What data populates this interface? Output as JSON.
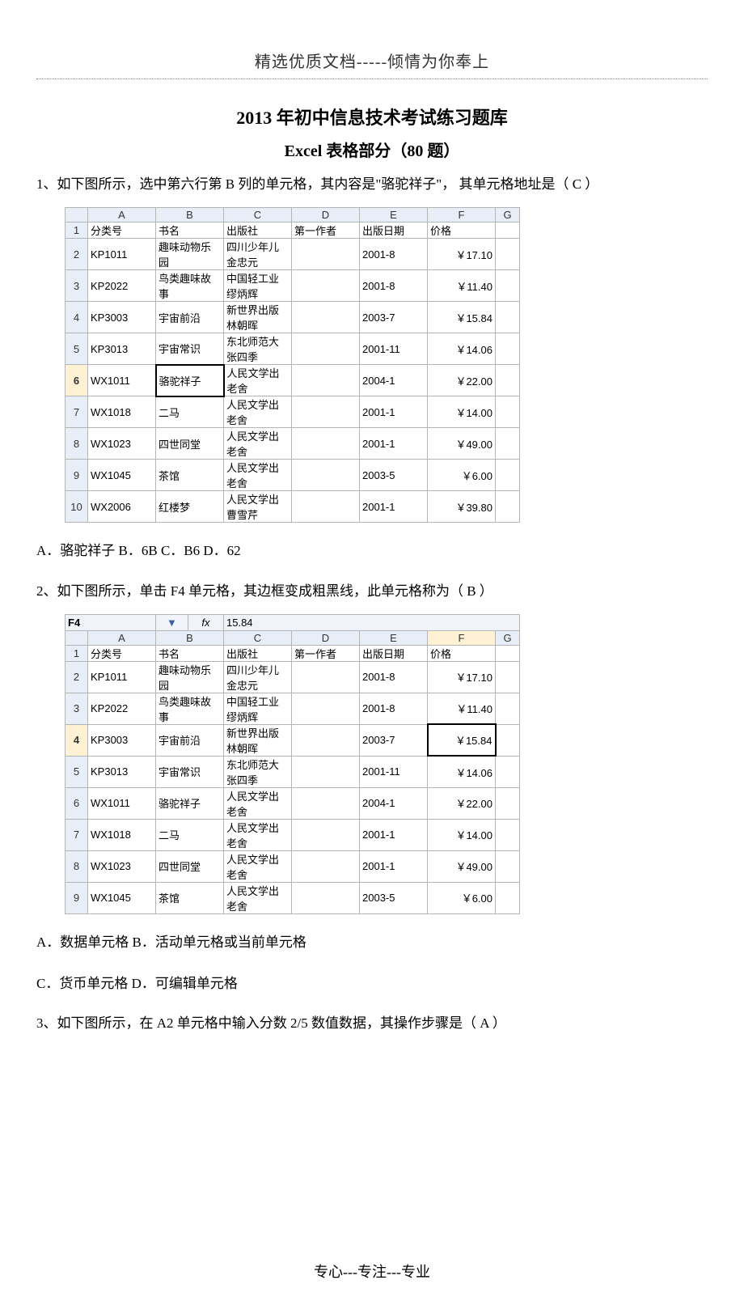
{
  "header": "精选优质文档-----倾情为你奉上",
  "title": "2013 年初中信息技术考试练习题库",
  "subtitle": "Excel 表格部分（80 题）",
  "q1": {
    "text": "1、如下图所示，选中第六行第 B 列的单元格，其内容是\"骆驼祥子\"， 其单元格地址是（   C        ）",
    "columns": [
      "A",
      "B",
      "C",
      "D",
      "E",
      "F",
      "G"
    ],
    "rows": [
      [
        "1",
        "分类号",
        "书名",
        "出版社",
        "第一作者",
        "出版日期",
        "价格",
        ""
      ],
      [
        "2",
        "KP1011",
        "趣味动物乐园",
        "四川少年儿金忠元",
        "",
        "2001-8",
        "￥17.10",
        ""
      ],
      [
        "3",
        "KP2022",
        "鸟类趣味故事",
        "中国轻工业缪炳辉",
        "",
        "2001-8",
        "￥11.40",
        ""
      ],
      [
        "4",
        "KP3003",
        "宇宙前沿",
        "新世界出版林朝晖",
        "",
        "2003-7",
        "￥15.84",
        ""
      ],
      [
        "5",
        "KP3013",
        "宇宙常识",
        "东北师范大张四季",
        "",
        "2001-11",
        "￥14.06",
        ""
      ],
      [
        "6",
        "WX1011",
        "骆驼祥子",
        "人民文学出老舍",
        "",
        "2004-1",
        "￥22.00",
        ""
      ],
      [
        "7",
        "WX1018",
        "二马",
        "人民文学出老舍",
        "",
        "2001-1",
        "￥14.00",
        ""
      ],
      [
        "8",
        "WX1023",
        "四世同堂",
        "人民文学出老舍",
        "",
        "2001-1",
        "￥49.00",
        ""
      ],
      [
        "9",
        "WX1045",
        "茶馆",
        "人民文学出老舍",
        "",
        "2003-5",
        "￥6.00",
        ""
      ],
      [
        "10",
        "WX2006",
        "红楼梦",
        "人民文学出曹雪芹",
        "",
        "2001-1",
        "￥39.80",
        ""
      ]
    ],
    "options": "A．骆驼祥子     B．6B       C．B6    D．62"
  },
  "q2": {
    "text": "2、如下图所示，单击 F4 单元格，其边框变成粗黑线，此单元格称为（     B     ）",
    "namebox": "F4",
    "formula": "15.84",
    "fx": "fx",
    "arrow": "▼",
    "columns": [
      "A",
      "B",
      "C",
      "D",
      "E",
      "F",
      "G"
    ],
    "rows": [
      [
        "1",
        "分类号",
        "书名",
        "出版社",
        "第一作者",
        "出版日期",
        "价格",
        ""
      ],
      [
        "2",
        "KP1011",
        "趣味动物乐园",
        "四川少年儿金忠元",
        "",
        "2001-8",
        "￥17.10",
        ""
      ],
      [
        "3",
        "KP2022",
        "鸟类趣味故事",
        "中国轻工业缪炳辉",
        "",
        "2001-8",
        "￥11.40",
        ""
      ],
      [
        "4",
        "KP3003",
        "宇宙前沿",
        "新世界出版林朝晖",
        "",
        "2003-7",
        "￥15.84",
        ""
      ],
      [
        "5",
        "KP3013",
        "宇宙常识",
        "东北师范大张四季",
        "",
        "2001-11",
        "￥14.06",
        ""
      ],
      [
        "6",
        "WX1011",
        "骆驼祥子",
        "人民文学出老舍",
        "",
        "2004-1",
        "￥22.00",
        ""
      ],
      [
        "7",
        "WX1018",
        "二马",
        "人民文学出老舍",
        "",
        "2001-1",
        "￥14.00",
        ""
      ],
      [
        "8",
        "WX1023",
        "四世同堂",
        "人民文学出老舍",
        "",
        "2001-1",
        "￥49.00",
        ""
      ],
      [
        "9",
        "WX1045",
        "茶馆",
        "人民文学出老舍",
        "",
        "2003-5",
        "￥6.00",
        ""
      ]
    ],
    "options_line1": "A．数据单元格      B．活动单元格或当前单元格",
    "options_line2": "C．货币单元格      D．可编辑单元格"
  },
  "q3": {
    "text": "3、如下图所示，在 A2 单元格中输入分数 2/5 数值数据，其操作步骤是（     A       ）"
  },
  "footer": "专心---专注---专业"
}
